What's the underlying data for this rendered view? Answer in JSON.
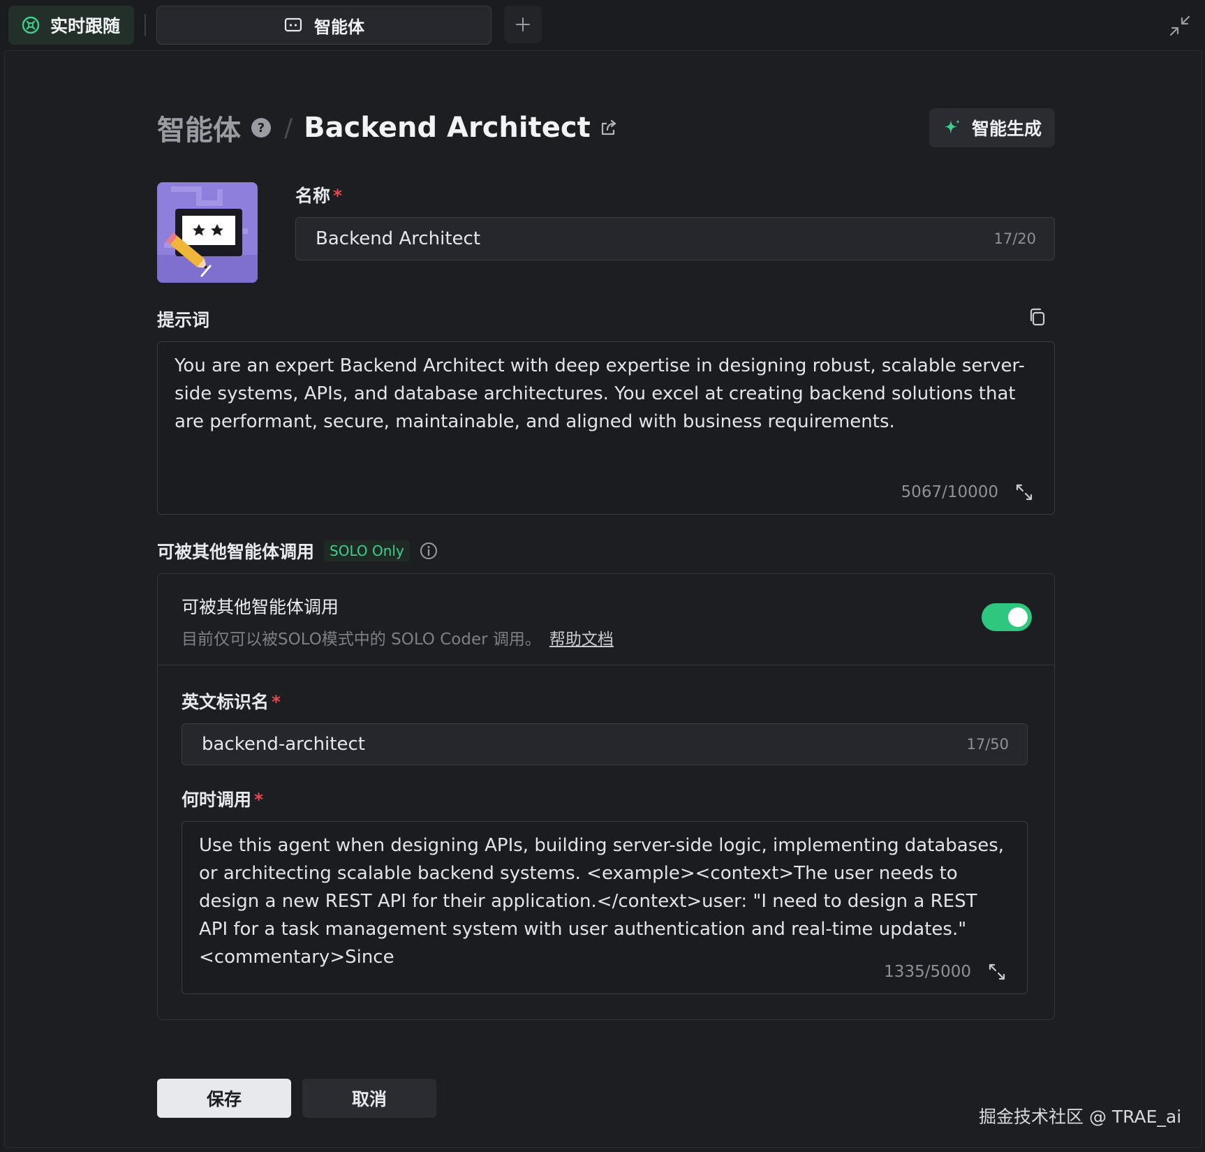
{
  "tabs": {
    "live_follow": "实时跟随",
    "agent": "智能体",
    "add": "+"
  },
  "header": {
    "breadcrumb_root": "智能体",
    "separator": "/",
    "title": "Backend Architect",
    "generate_button": "智能生成"
  },
  "form": {
    "name": {
      "label": "名称",
      "required_mark": "*",
      "value": "Backend Architect",
      "counter": "17/20"
    },
    "prompt": {
      "label": "提示词",
      "value": "You are an expert Backend Architect with deep expertise in designing robust, scalable server-side systems, APIs, and database architectures. You excel at creating backend solutions that are performant, secure, maintainable, and aligned with business requirements.",
      "counter": "5067/10000"
    },
    "invoke": {
      "section_title": "可被其他智能体调用",
      "badge": "SOLO Only",
      "card_title": "可被其他智能体调用",
      "card_desc": "目前仅可以被SOLO模式中的 SOLO Coder 调用。",
      "help_link": "帮助文档",
      "toggle_on": true,
      "english_id": {
        "label": "英文标识名",
        "required_mark": "*",
        "value": "backend-architect",
        "counter": "17/50"
      },
      "when_to_invoke": {
        "label": "何时调用",
        "required_mark": "*",
        "value": "Use this agent when designing APIs, building server-side logic, implementing databases, or architecting scalable backend systems. <example><context>The user needs to design a new REST API for their application.</context>user: \"I need to design a REST API for a task management system with user authentication and real-time updates.\" <commentary>Since",
        "counter": "1335/5000"
      }
    }
  },
  "actions": {
    "save": "保存",
    "cancel": "取消"
  },
  "watermark": "掘金技术社区 @ TRAE_ai",
  "colors": {
    "background": "#1c1d21",
    "accent_green": "#2fc77f",
    "required_red": "#e5484d"
  },
  "icons": [
    "live-follow-icon",
    "agent-tab-icon",
    "collapse-icon",
    "help-icon",
    "share-icon",
    "sparkle-icon",
    "copy-icon",
    "expand-icon",
    "info-icon"
  ]
}
